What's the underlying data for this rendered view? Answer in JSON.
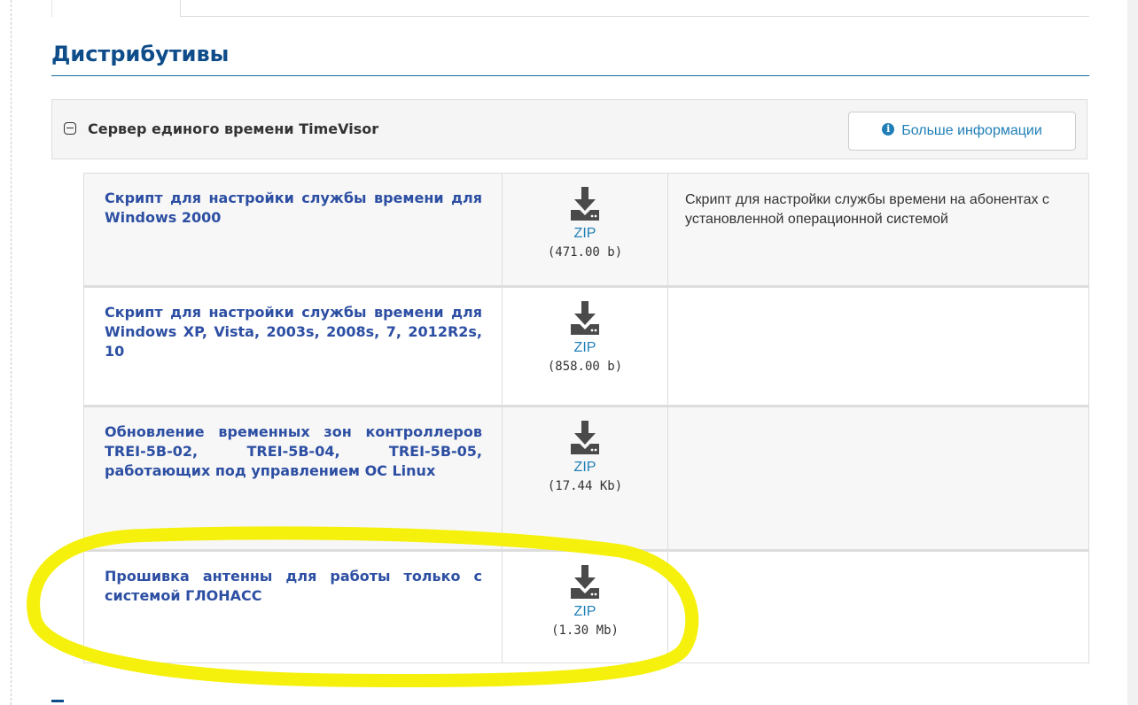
{
  "section": {
    "title": "Дистрибутивы"
  },
  "product": {
    "name": "Сервер единого времени TimeVisor",
    "more_info_label": "Больше информации"
  },
  "files": [
    {
      "title": "Скрипт для настройки службы времени для Windows 2000",
      "format": "ZIP",
      "size": "(471.00 b)",
      "description": "Скрипт для настройки службы времени на абонентах с установленной операционной системой"
    },
    {
      "title": "Скрипт для настройки службы времени для Windows XP, Vista, 2003s, 2008s, 7, 2012R2s, 10",
      "format": "ZIP",
      "size": "(858.00 b)",
      "description": ""
    },
    {
      "title": "Обновление временных зон контроллеров TREI-5B-02, TREI-5B-04, TREI-5B-05, работающих под управлением ОС Linux",
      "format": "ZIP",
      "size": "(17.44 Kb)",
      "description": ""
    },
    {
      "title": "Прошивка антенны для работы только с системой ГЛОНАСС",
      "format": "ZIP",
      "size": "(1.30 Mb)",
      "description": ""
    }
  ],
  "icons": {
    "collapse": "minus-square-icon",
    "info": "info-circle-icon",
    "download": "download-icon"
  },
  "colors": {
    "heading": "#0e4c8a",
    "link": "#2d4fa3",
    "accent": "#1f7fb6",
    "highlight": "#f4f000"
  }
}
